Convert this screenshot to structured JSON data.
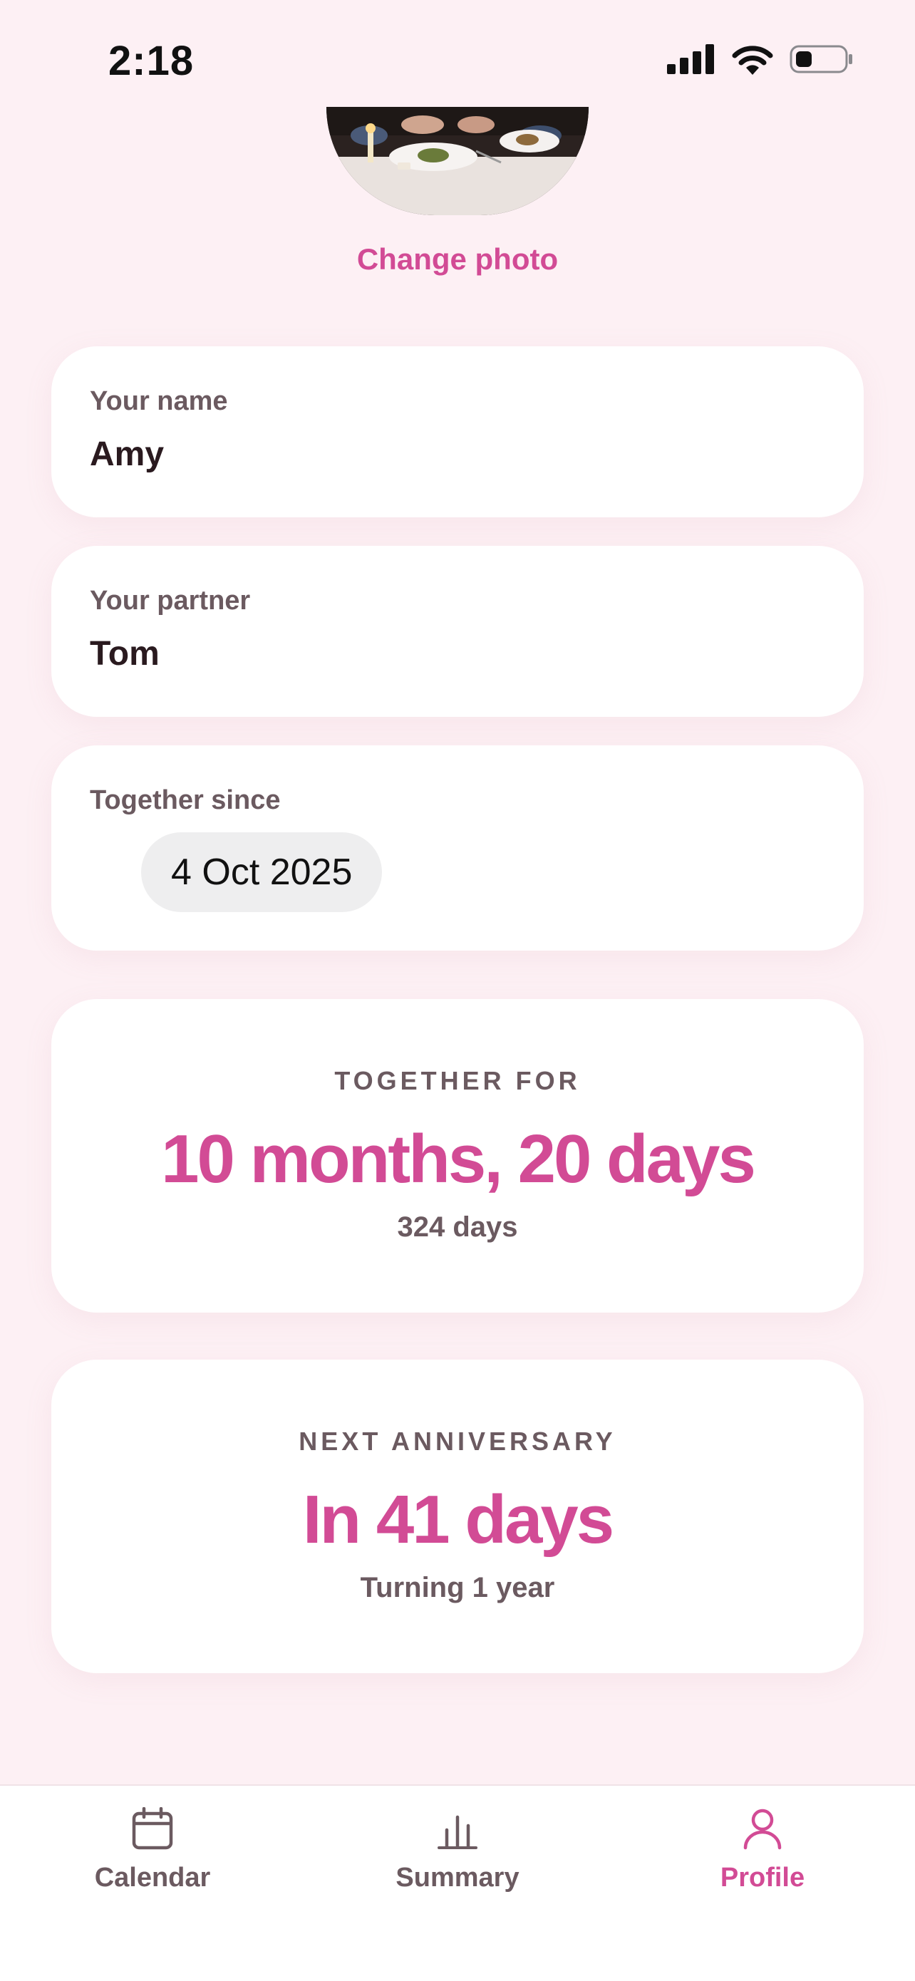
{
  "status_bar": {
    "time": "2:18"
  },
  "profile": {
    "change_photo_label": "Change photo"
  },
  "fields": {
    "name": {
      "label": "Your name",
      "value": "Amy"
    },
    "partner": {
      "label": "Your partner",
      "value": "Tom"
    },
    "since": {
      "label": "Together since",
      "value": "4 Oct 2025"
    }
  },
  "together": {
    "kicker": "TOGETHER FOR",
    "headline": "10 months, 20 days",
    "sub": "324 days"
  },
  "anniversary": {
    "kicker": "NEXT ANNIVERSARY",
    "headline": "In 41 days",
    "sub": "Turning 1 year"
  },
  "tabs": [
    {
      "label": "Calendar",
      "icon": "calendar-icon",
      "active": false
    },
    {
      "label": "Summary",
      "icon": "bar-chart-icon",
      "active": false
    },
    {
      "label": "Profile",
      "icon": "person-icon",
      "active": true
    }
  ],
  "colors": {
    "accent": "#d24b95",
    "background": "#fdf0f4",
    "muted": "#6b5a60"
  }
}
